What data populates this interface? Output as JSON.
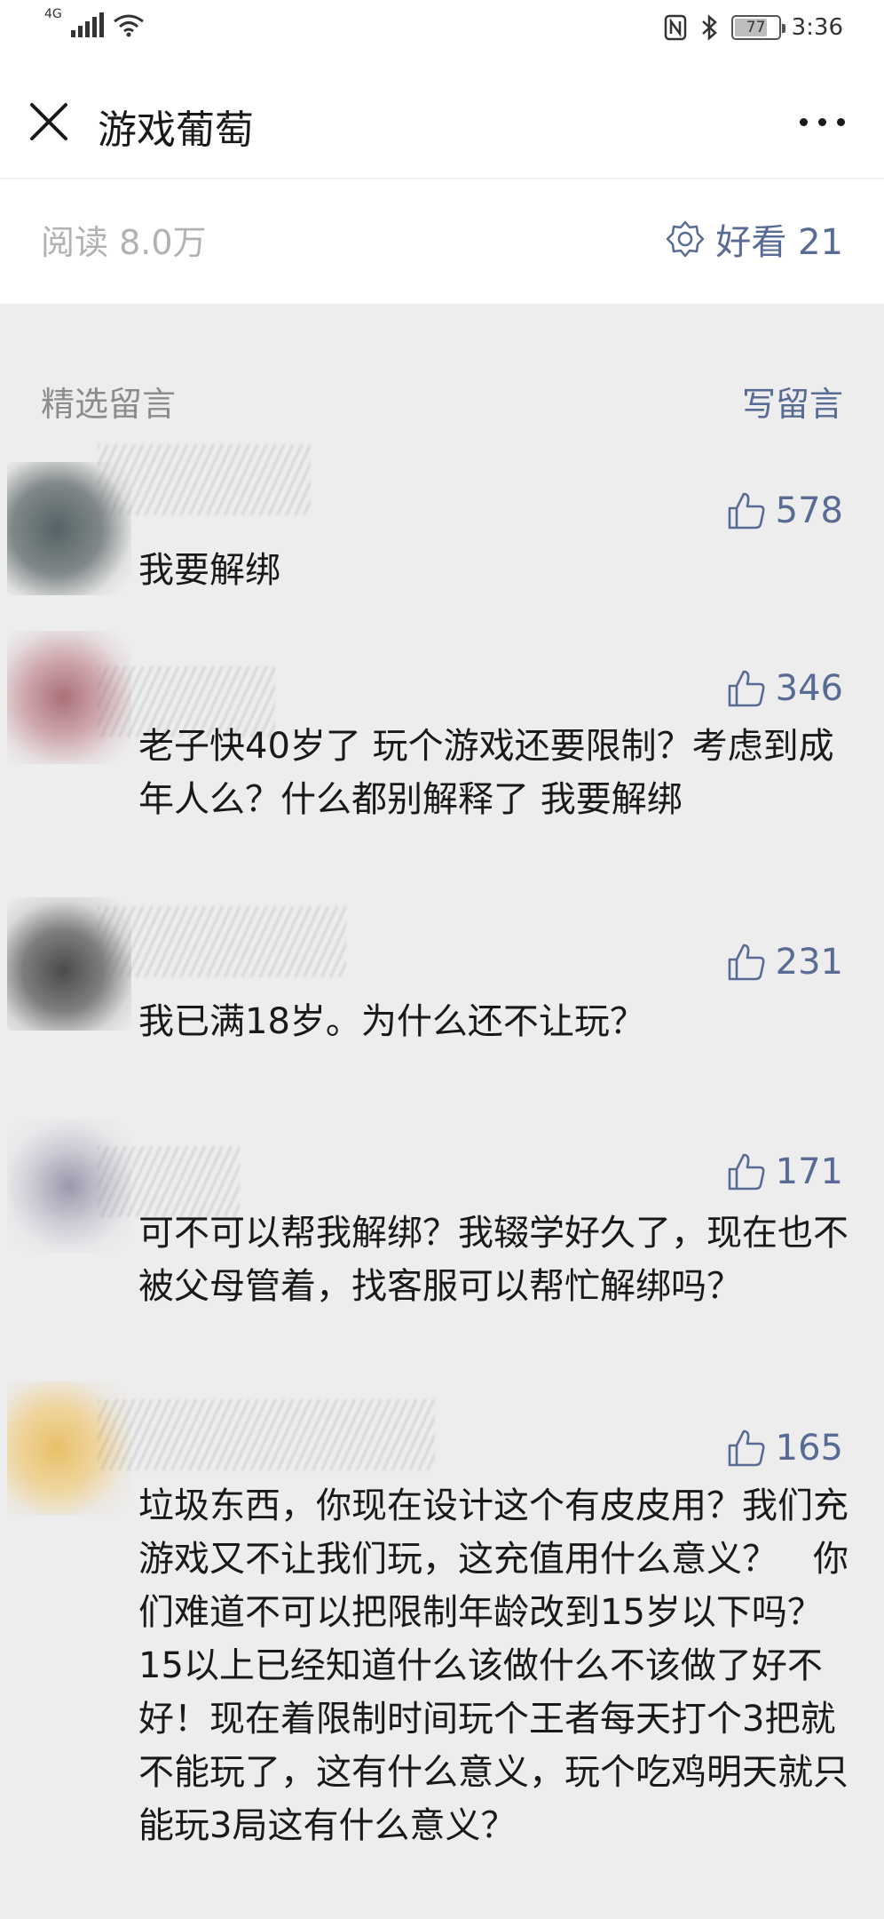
{
  "status_bar": {
    "network": "4G",
    "battery": "77",
    "battery_level": 0.77,
    "time": "3:36"
  },
  "nav": {
    "title": "游戏葡萄"
  },
  "stats": {
    "read_count": "阅读 8.0万",
    "wow_label": "好看 21"
  },
  "comments_section": {
    "header": "精选留言",
    "write_label": "写留言"
  },
  "comments": [
    {
      "likes": "578",
      "text": "我要解绑"
    },
    {
      "likes": "346",
      "text": "老子快40岁了 玩个游戏还要限制？考虑到成年人么？什么都别解释了 我要解绑"
    },
    {
      "likes": "231",
      "text": "我已满18岁。为什么还不让玩？"
    },
    {
      "likes": "171",
      "text": "可不可以帮我解绑？我辍学好久了，现在也不被父母管着，找客服可以帮忙解绑吗？"
    },
    {
      "likes": "165",
      "text": "垃圾东西，你现在设计这个有皮皮用？我们充游戏又不让我们玩，这充值用什么意义？　你们难道不可以把限制年龄改到15岁以下吗？15以上已经知道什么该做什么不该做了好不好！现在着限制时间玩个王者每天打个3把就不能玩了，这有什么意义，玩个吃鸡明天就只能玩3局这有什么意义？"
    }
  ],
  "colors": {
    "link_blue": "#576b95",
    "muted_gray": "#b2b2b2",
    "page_bg": "#ededed"
  },
  "icons": [
    "close-icon",
    "more-icon",
    "wow-icon",
    "thumb-up-icon",
    "nfc-icon",
    "bluetooth-icon",
    "wifi-icon",
    "signal-icon",
    "battery-icon"
  ]
}
